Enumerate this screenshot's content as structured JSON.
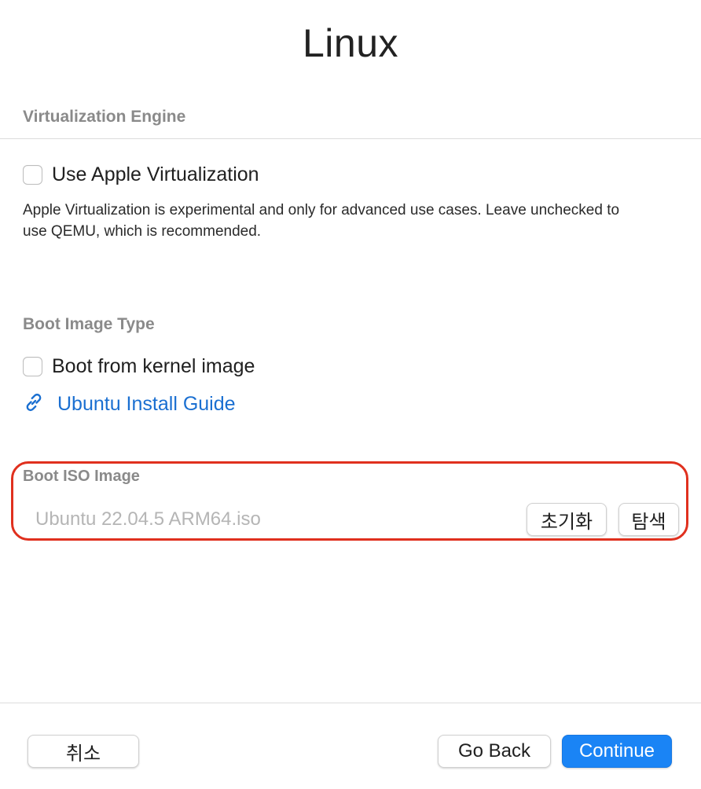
{
  "window": {
    "title": "Linux"
  },
  "virtualization": {
    "header": "Virtualization Engine",
    "checkbox_label": "Use Apple Virtualization",
    "checked": false,
    "description": "Apple Virtualization is experimental and only for advanced use cases. Leave unchecked to use QEMU, which is recommended."
  },
  "boot_image_type": {
    "header": "Boot Image Type",
    "checkbox_label": "Boot from kernel image",
    "checked": false,
    "link_label": "Ubuntu Install Guide",
    "link_icon": "link-icon",
    "link_color": "#1a6fd1"
  },
  "boot_iso": {
    "header": "Boot ISO Image",
    "file_value": "Ubuntu 22.04.5 ARM64.iso",
    "clear_label": "초기화",
    "browse_label": "탐색",
    "highlight_color": "#e0301e"
  },
  "footer": {
    "cancel_label": "취소",
    "back_label": "Go Back",
    "continue_label": "Continue",
    "accent_color": "#1a84f5"
  }
}
